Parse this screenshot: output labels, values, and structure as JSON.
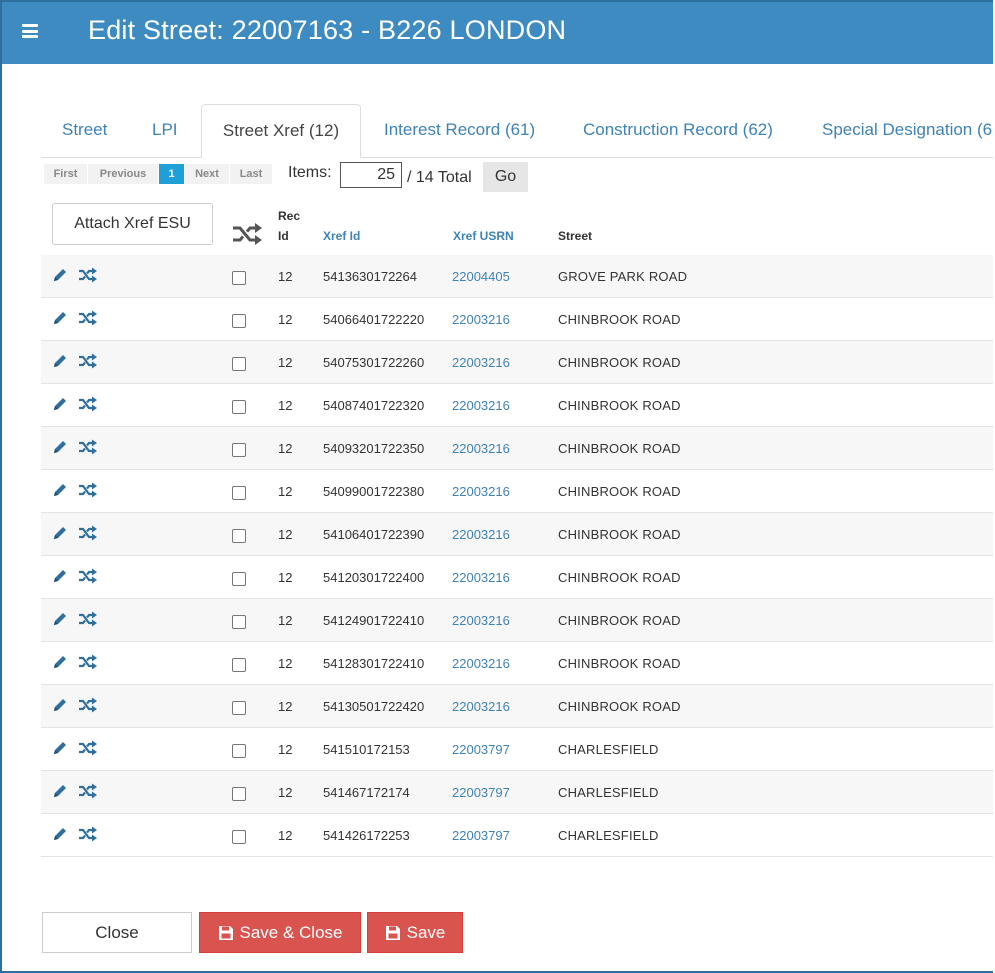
{
  "header": {
    "title": "Edit Street: 22007163 - B226 LONDON"
  },
  "tabs": [
    {
      "label": "Street"
    },
    {
      "label": "LPI"
    },
    {
      "label": "Street Xref (12)"
    },
    {
      "label": "Interest Record (61)"
    },
    {
      "label": "Construction Record (62)"
    },
    {
      "label": "Special Designation (6"
    }
  ],
  "pager": {
    "first": "First",
    "previous": "Previous",
    "current": "1",
    "next": "Next",
    "last": "Last",
    "items_label": "Items:",
    "items_value": "25",
    "total": "/ 14 Total",
    "go": "Go"
  },
  "toolbar": {
    "attach": "Attach Xref ESU"
  },
  "columns": {
    "rec_id_1": "Rec",
    "rec_id_2": "Id",
    "xref_id": "Xref Id",
    "xref_usrn": "Xref USRN",
    "street": "Street"
  },
  "rows": [
    {
      "rec": "12",
      "xref_id": "5413630172264",
      "usrn": "22004405",
      "street": "GROVE PARK ROAD"
    },
    {
      "rec": "12",
      "xref_id": "54066401722220",
      "usrn": "22003216",
      "street": "CHINBROOK ROAD"
    },
    {
      "rec": "12",
      "xref_id": "54075301722260",
      "usrn": "22003216",
      "street": "CHINBROOK ROAD"
    },
    {
      "rec": "12",
      "xref_id": "54087401722320",
      "usrn": "22003216",
      "street": "CHINBROOK ROAD"
    },
    {
      "rec": "12",
      "xref_id": "54093201722350",
      "usrn": "22003216",
      "street": "CHINBROOK ROAD"
    },
    {
      "rec": "12",
      "xref_id": "54099001722380",
      "usrn": "22003216",
      "street": "CHINBROOK ROAD"
    },
    {
      "rec": "12",
      "xref_id": "54106401722390",
      "usrn": "22003216",
      "street": "CHINBROOK ROAD"
    },
    {
      "rec": "12",
      "xref_id": "54120301722400",
      "usrn": "22003216",
      "street": "CHINBROOK ROAD"
    },
    {
      "rec": "12",
      "xref_id": "54124901722410",
      "usrn": "22003216",
      "street": "CHINBROOK ROAD"
    },
    {
      "rec": "12",
      "xref_id": "54128301722410",
      "usrn": "22003216",
      "street": "CHINBROOK ROAD"
    },
    {
      "rec": "12",
      "xref_id": "54130501722420",
      "usrn": "22003216",
      "street": "CHINBROOK ROAD"
    },
    {
      "rec": "12",
      "xref_id": "541510172153",
      "usrn": "22003797",
      "street": "CHARLESFIELD"
    },
    {
      "rec": "12",
      "xref_id": "541467172174",
      "usrn": "22003797",
      "street": "CHARLESFIELD"
    },
    {
      "rec": "12",
      "xref_id": "541426172253",
      "usrn": "22003797",
      "street": "CHARLESFIELD"
    }
  ],
  "footer": {
    "close": "Close",
    "save_close": "Save & Close",
    "save": "Save"
  },
  "colors": {
    "header": "#3d8bc0",
    "link": "#3f82b5",
    "danger": "#d9534f",
    "pager_active": "#1e9fd8"
  },
  "icons": [
    "menu-icon",
    "pencil-icon",
    "shuffle-icon",
    "floppy-disk-icon"
  ]
}
